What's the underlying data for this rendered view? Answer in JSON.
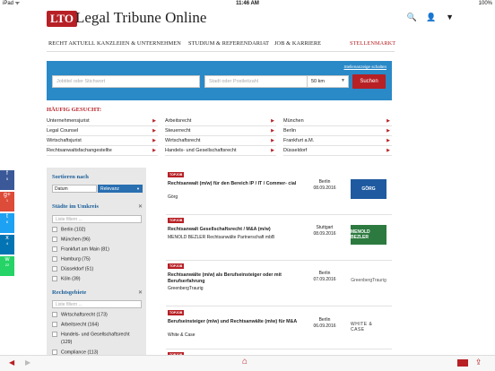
{
  "status": {
    "left": "iPad ᯤ",
    "time": "11:46 AM",
    "right": "100%"
  },
  "header": {
    "logo_box": "LTO",
    "logo_text": "Legal Tribune Online"
  },
  "nav": [
    "RECHT AKTUELL",
    "KANZLEIEN & UNTERNEHMEN",
    "STUDIUM & REFERENDARIAT",
    "JOB & KARRIERE",
    "STELLENMARKT"
  ],
  "search": {
    "alert_link": "Stellenanzeige schalten",
    "keyword_placeholder": "Jobtitel oder Stichwort",
    "location_placeholder": "Stadt oder Postleitzahl",
    "radius": "50 km",
    "button": "Suchen"
  },
  "haeufig": {
    "title": "HÄUFIG GESUCHT:",
    "col1": [
      "Unternehmensjurist",
      "Legal Counsel",
      "Wirtschaftsjurist",
      "Rechtsanwaltsfachangestellte"
    ],
    "col2": [
      "Arbeitsrecht",
      "Steuerrecht",
      "Wirtschaftsrecht",
      "Handels- und Gesellschaftsrecht"
    ],
    "col3": [
      "München",
      "Berlin",
      "Frankfurt a.M.",
      "Düsseldorf"
    ]
  },
  "sidebar": {
    "sort_title": "Sortieren nach",
    "sort_options": [
      "Datum",
      "Relevanz"
    ],
    "cities_title": "Städte im Umkreis",
    "filter_placeholder": "Liste filtern ...",
    "cities": [
      "Berlin (102)",
      "München (96)",
      "Frankfurt am Main (81)",
      "Hamburg (75)",
      "Düsseldorf (51)",
      "Köln (39)"
    ],
    "areas_title": "Rechtsgebiete",
    "areas": [
      "Wirtschaftsrecht (173)",
      "Arbeitsrecht (164)",
      "Handels- und Gesellschaftsrecht",
      "(129)",
      "Compliance (113)"
    ]
  },
  "jobs": [
    {
      "badge": "TOPJOB",
      "title": "Rechtsanwalt (m/w) für den Bereich IP / IT / Commer- cial",
      "company": "Görg",
      "city": "Berlin",
      "date": "08.09.2016",
      "logo": "GÖRG"
    },
    {
      "badge": "TOPJOB",
      "title": "Rechtsanwalt Gesellschaftsrecht / M&A (m/w)",
      "company": "MENOLD BEZLER Rechtsanwälte Partnerschaft mbB",
      "city": "Stuttgart",
      "date": "08.09.2016",
      "logo": "MENOLD BEZLER"
    },
    {
      "badge": "TOPJOB",
      "title": "Rechtsanwälte (m/w) als Berufseinsteiger oder mit Berufserfahrung",
      "company": "GreenbergTraurig",
      "city": "Berlin",
      "date": "07.09.2016",
      "logo": "GreenbergTraurig"
    },
    {
      "badge": "TOPJOB",
      "title": "Berufseinsteiger (m/w) und Rechtsanwälte (m/w) für M&A",
      "company": "White & Case",
      "city": "Berlin",
      "date": "06.09.2016",
      "logo": "WHITE & CASE"
    },
    {
      "badge": "TOPJOB"
    }
  ],
  "social": [
    {
      "icon": "f",
      "count": "5",
      "color": "#3b5998"
    },
    {
      "icon": "g+",
      "count": "1",
      "color": "#dd4b39"
    },
    {
      "icon": "t",
      "count": "6",
      "color": "#1da1f2"
    },
    {
      "icon": "x",
      "count": "4",
      "color": "#0274b3"
    },
    {
      "icon": "w",
      "count": "22",
      "color": "#25d366"
    }
  ],
  "colors": {
    "brand": "#b72025",
    "search_bg": "#2a89c7"
  }
}
